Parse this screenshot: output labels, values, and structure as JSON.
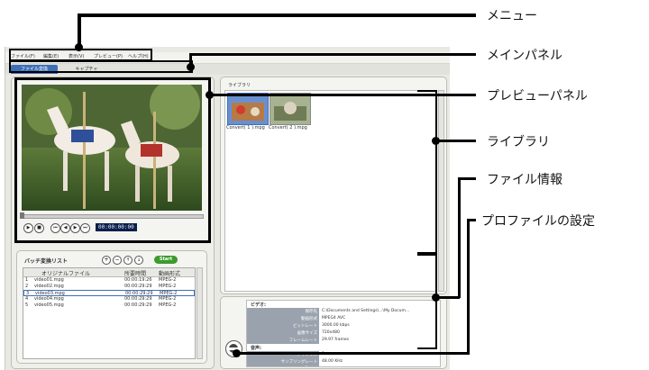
{
  "menu": {
    "items": [
      "ファイル(F)",
      "編集(E)",
      "表示(V)",
      "プレビュー(P)",
      "ヘルプ(H)"
    ]
  },
  "tabs": [
    {
      "label": "ファイル変換",
      "active": true
    },
    {
      "label": "キャプチャ",
      "active": false
    }
  ],
  "preview": {
    "timecode": "00:00:00:00",
    "controls": [
      "play-icon",
      "stop-icon",
      "previous-icon",
      "rewind-icon",
      "fast-forward-icon",
      "next-icon"
    ]
  },
  "batch": {
    "title": "バッチ変換リスト",
    "start_label": "Start",
    "headers": [
      "",
      "オリジナルファイル",
      "所要時間",
      "動画形式"
    ],
    "rows": [
      [
        "1",
        "video01.mpg",
        "00:00:19:26",
        "MPEG-2"
      ],
      [
        "2",
        "video02.mpg",
        "00:00:29:29",
        "MPEG-2"
      ],
      [
        "3",
        "video03.mpg",
        "00:00:29:29",
        "MPEG-2"
      ],
      [
        "4",
        "video04.mpg",
        "00:00:29:29",
        "MPEG-2"
      ],
      [
        "5",
        "video05.mpg",
        "00:00:29:29",
        "MPEG-2"
      ]
    ],
    "selected_row": 2
  },
  "library": {
    "title": "ライブラリ",
    "captions": [
      "Convert( 1 ).mpg",
      "Convert( 2 ).mpg"
    ]
  },
  "fileinfo": {
    "video_title": "ビデオ:",
    "video_rows": [
      {
        "label": "保存先",
        "value": "C:\\Documents and Settings\\...\\My Docum..."
      },
      {
        "label": "動画形式",
        "value": "MPEG4 AVC"
      },
      {
        "label": "ビットレート",
        "value": "3000.00 kbps"
      },
      {
        "label": "画像サイズ",
        "value": "720x480"
      },
      {
        "label": "フレームレート",
        "value": "29.97 frames"
      }
    ],
    "audio_title": "音声:",
    "audio_rows": [
      {
        "label": "チャンネル",
        "value": "2"
      },
      {
        "label": "サンプリングレート",
        "value": "48.00 KHz"
      },
      {
        "label": "Codec",
        "value": "MPEG-1 Layer II ステレオ"
      }
    ]
  },
  "callouts": [
    "メニュー",
    "メインパネル",
    "プレビューパネル",
    "ライブラリ",
    "ファイル情報",
    "プロファイルの設定"
  ],
  "colors": {
    "accent": "#3d6fb8",
    "video_bg": "#233041",
    "annotation": "#000000"
  }
}
